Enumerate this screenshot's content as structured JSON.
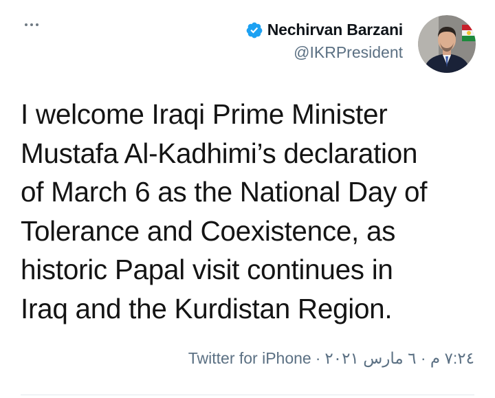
{
  "author": {
    "name": "Nechirvan Barzani",
    "handle": "@IKRPresident",
    "verified": true,
    "avatar_icon": "profile-photo"
  },
  "tweet": {
    "text": "I welcome Iraqi Prime Minister\nMustafa Al-Kadhimi’s declaration\nof March 6 as the National Day of\nTolerance and Coexistence, as\nhistoric Papal visit continues in\nIraq and the Kurdistan Region."
  },
  "meta": {
    "timestamp": "٧:٢٤ م · ٦ مارس ٢٠٢١",
    "separator": "·",
    "source": "Twitter for iPhone"
  },
  "colors": {
    "verified_blue": "#1da1f2",
    "secondary_text": "#5b7083",
    "divider": "#e1e8ed"
  }
}
